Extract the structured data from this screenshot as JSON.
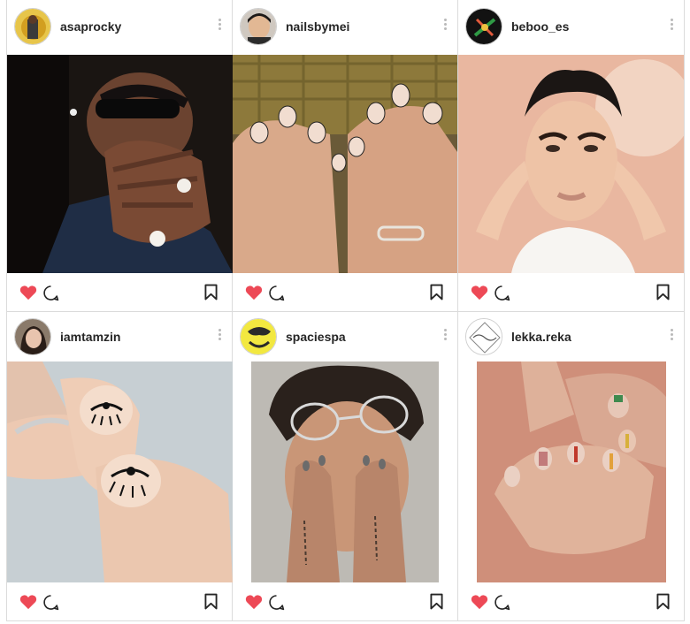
{
  "posts": [
    {
      "username": "asaprocky",
      "avatar_icon": "person-portrait-icon",
      "photo_icon": "hands-over-face-photo"
    },
    {
      "username": "nailsbymei",
      "avatar_icon": "person-portrait-icon",
      "photo_icon": "lettered-nails-photo"
    },
    {
      "username": "beboo_es",
      "avatar_icon": "embroidery-logo-icon",
      "photo_icon": "makeup-portrait-photo"
    },
    {
      "username": "iamtamzin",
      "avatar_icon": "person-portrait-icon",
      "photo_icon": "eye-nail-art-photo"
    },
    {
      "username": "spaciespa",
      "avatar_icon": "yellow-logo-icon",
      "photo_icon": "glasses-portrait-photo"
    },
    {
      "username": "lekka.reka",
      "avatar_icon": "script-logo-icon",
      "photo_icon": "striped-nails-photo"
    }
  ],
  "icons": {
    "heart": "heart-icon",
    "comment": "comment-icon",
    "bookmark": "bookmark-icon",
    "more": "more-options-icon"
  },
  "colors": {
    "like_red": "#ed4956",
    "username_text": "#262626",
    "border": "#dbdbdb"
  }
}
